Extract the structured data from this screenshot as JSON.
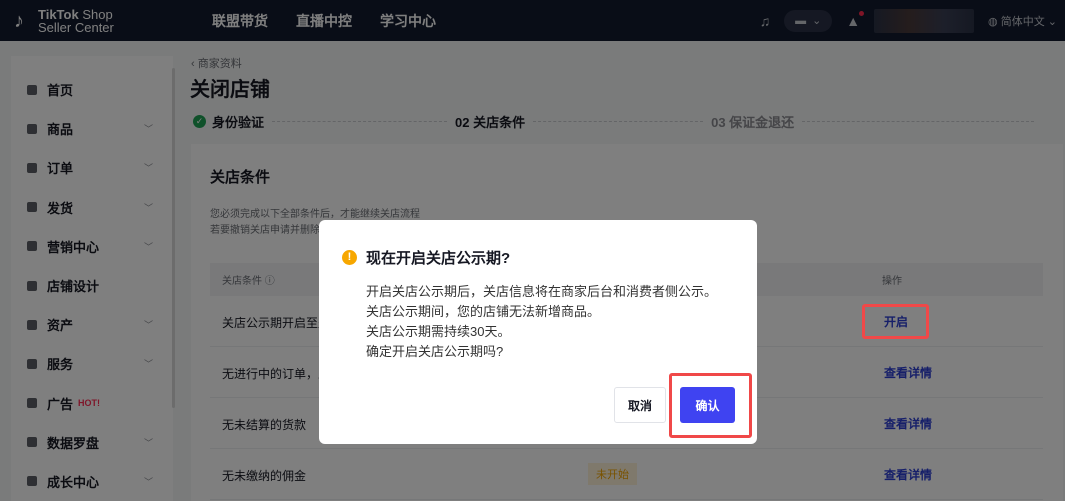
{
  "topbar": {
    "logo_line1_bold": "TikTok",
    "logo_line1_rest": " Shop",
    "logo_line2": "Seller Center",
    "nav": [
      "联盟带货",
      "直播中控",
      "学习中心"
    ],
    "language": "简体中文"
  },
  "sidebar": {
    "items": [
      {
        "label": "首页",
        "has_chevron": false
      },
      {
        "label": "商品",
        "has_chevron": true
      },
      {
        "label": "订单",
        "has_chevron": true
      },
      {
        "label": "发货",
        "has_chevron": true
      },
      {
        "label": "营销中心",
        "has_chevron": true
      },
      {
        "label": "店铺设计",
        "has_chevron": false
      },
      {
        "label": "资产",
        "has_chevron": true
      },
      {
        "label": "服务",
        "has_chevron": true
      },
      {
        "label": "广告",
        "badge": "HOT!",
        "has_chevron": false
      },
      {
        "label": "数据罗盘",
        "has_chevron": true
      },
      {
        "label": "成长中心",
        "has_chevron": true
      }
    ]
  },
  "breadcrumb": "商家资料",
  "page_title": "关闭店铺",
  "steps": [
    {
      "label": "身份验证",
      "state": "done"
    },
    {
      "label": "02 关店条件",
      "state": "active"
    },
    {
      "label": "03 保证金退还",
      "state": "pending"
    }
  ],
  "card": {
    "title": "关店条件",
    "desc_line1": "您必须完成以下全部条件后，才能继续关店流程",
    "desc_line2": "若要撤销关店申请并删除"
  },
  "table": {
    "headers": {
      "condition": "关店条件",
      "action": "操作"
    },
    "rows": [
      {
        "condition": "关店公示期开启至少",
        "status": "",
        "action": "开启"
      },
      {
        "condition": "无进行中的订单，且",
        "status": "",
        "action": "查看详情"
      },
      {
        "condition": "无未结算的货款",
        "status": "",
        "action": "查看详情"
      },
      {
        "condition": "无未缴纳的佣金",
        "status": "未开始",
        "action": "查看详情"
      }
    ]
  },
  "modal": {
    "title": "现在开启关店公示期?",
    "lines": [
      "开启关店公示期后，关店信息将在商家后台和消费者侧公示。",
      "关店公示期间，您的店铺无法新增商品。",
      "关店公示期需持续30天。",
      "确定开启关店公示期吗?"
    ],
    "cancel_label": "取消",
    "confirm_label": "确认"
  },
  "colors": {
    "topbar": "#121a2e",
    "primary": "#3f43f1",
    "link": "#2d3fd3",
    "warning": "#f7a700",
    "highlight": "#f04848"
  }
}
